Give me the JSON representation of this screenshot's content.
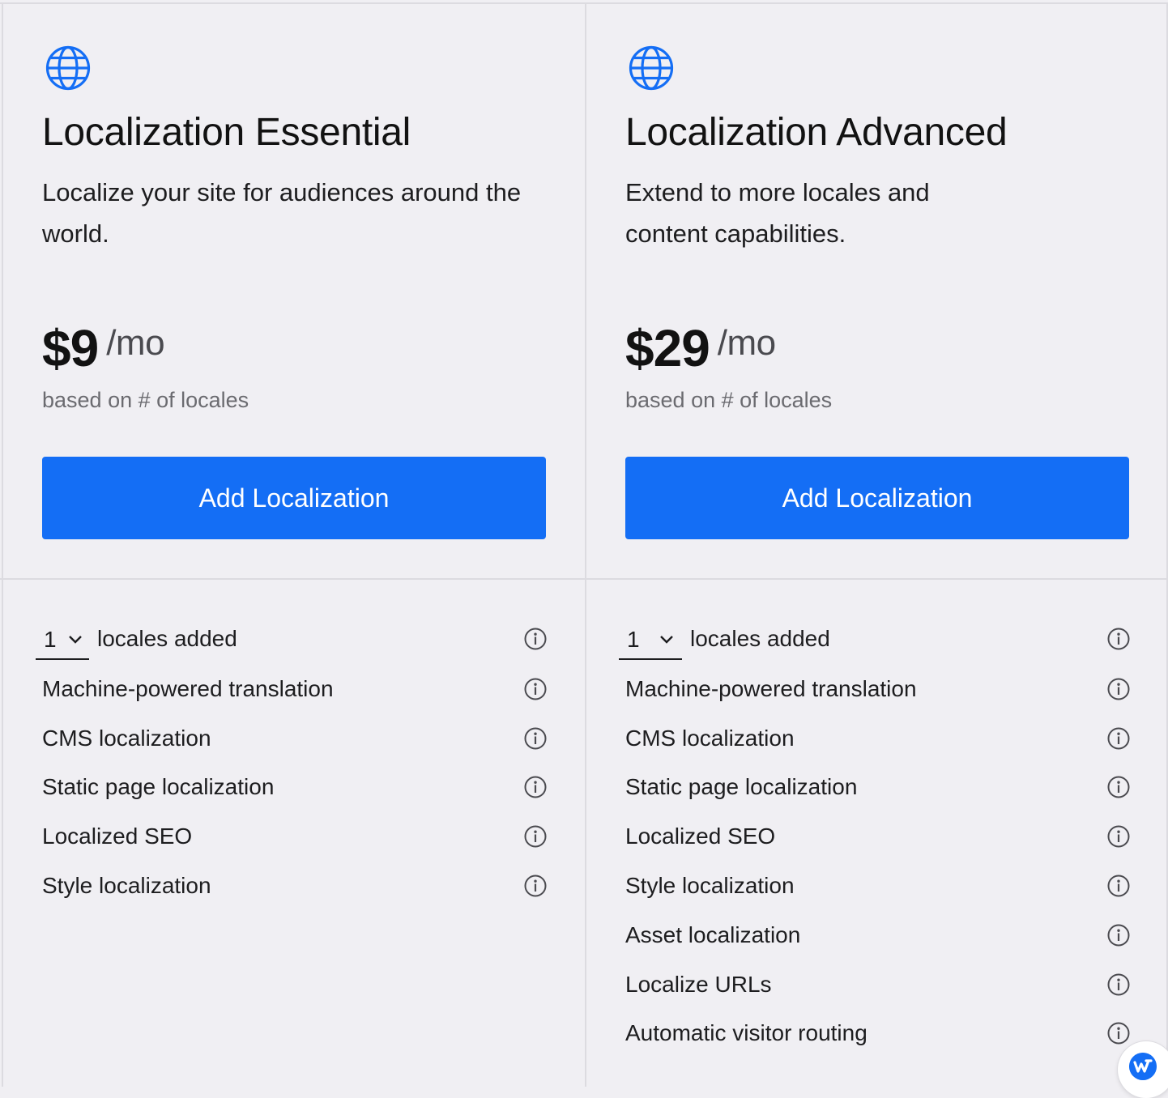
{
  "colors": {
    "accent": "#146ef5",
    "background": "#f0eff3",
    "border": "#dcdbe0"
  },
  "plans": [
    {
      "icon": "globe-icon",
      "title": "Localization Essential",
      "description": "Localize your site for audiences around the world.",
      "price": "$9",
      "price_unit": "/mo",
      "price_note": "based on # of locales",
      "cta_label": "Add Localization",
      "locales": {
        "value": "1",
        "label": "locales added"
      },
      "features": [
        "Machine-powered translation",
        "CMS localization",
        "Static page localization",
        "Localized SEO",
        "Style localization"
      ]
    },
    {
      "icon": "globe-icon",
      "title": "Localization Advanced",
      "description": "Extend to more locales and content capabilities.",
      "price": "$29",
      "price_unit": "/mo",
      "price_note": "based on # of locales",
      "cta_label": "Add Localization",
      "locales": {
        "value": "1",
        "label": "locales added"
      },
      "features": [
        "Machine-powered translation",
        "CMS localization",
        "Static page localization",
        "Localized SEO",
        "Style localization",
        "Asset localization",
        "Localize URLs",
        "Automatic visitor routing"
      ]
    }
  ],
  "badge": {
    "icon": "webflow-logo-icon"
  }
}
